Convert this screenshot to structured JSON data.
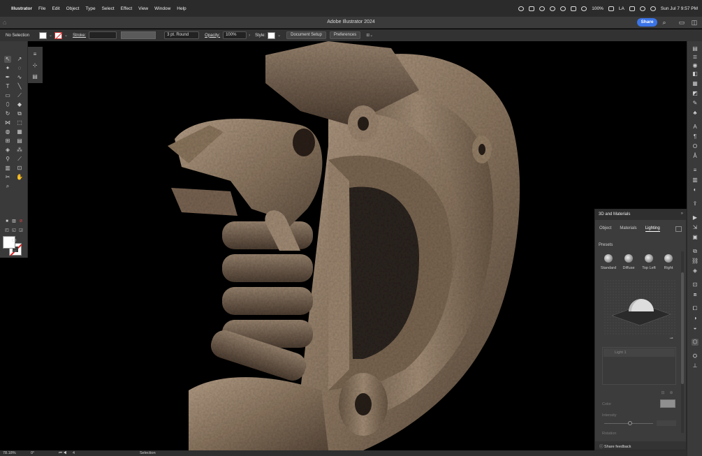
{
  "menubar": {
    "app_name": "Illustrator",
    "items": [
      "File",
      "Edit",
      "Object",
      "Type",
      "Select",
      "Effect",
      "View",
      "Window",
      "Help"
    ],
    "battery": "100%",
    "input_source": "LA",
    "datetime": "Sun Jul 7  9:57 PM"
  },
  "window": {
    "title": "Adobe Illustrator 2024",
    "share_label": "Share"
  },
  "controlbar": {
    "selection": "No Selection",
    "stroke_label": "Stroke:",
    "brush": "3 pt. Round",
    "opacity_label": "Opacity:",
    "opacity_value": "100%",
    "style_label": "Style:",
    "document_setup": "Document Setup",
    "preferences": "Preferences"
  },
  "panel": {
    "title": "3D and Materials",
    "tabs": [
      "Object",
      "Materials",
      "Lighting"
    ],
    "active_tab": "Lighting",
    "presets_label": "Presets",
    "presets": [
      "Standard",
      "Diffuse",
      "Top Left",
      "Right"
    ],
    "light_name": "Light 1",
    "color_label": "Color",
    "intensity_label": "Intensity",
    "rotation_label": "Rotation",
    "feedback": "Share feedback"
  },
  "statusbar": {
    "zoom": "78.18%",
    "rotation": "0°",
    "artboard": "4",
    "tool": "Selection"
  },
  "colors": {
    "share_button": "#3b74e6",
    "canvas": "#000000",
    "stone": "#8a7560"
  }
}
